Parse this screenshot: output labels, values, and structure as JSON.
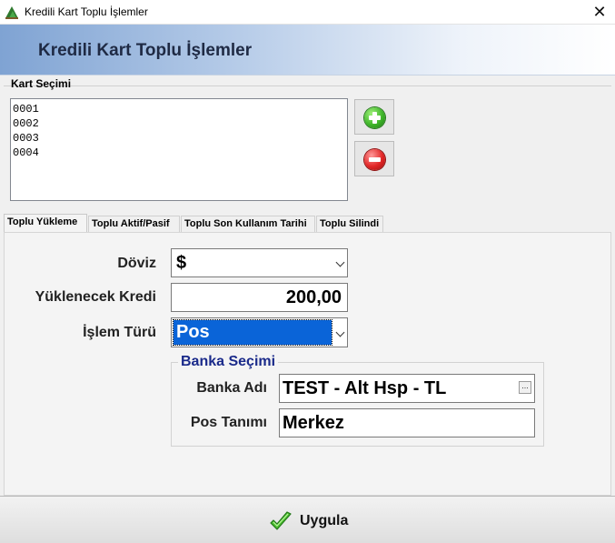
{
  "window": {
    "title": "Kredili Kart Toplu İşlemler",
    "close_symbol": "✕"
  },
  "header": {
    "heading": "Kredili Kart Toplu İşlemler"
  },
  "card_selection": {
    "label": "Kart Seçimi",
    "items": [
      "0001",
      "0002",
      "0003",
      "0004"
    ],
    "add_icon": "green-plus-icon",
    "remove_icon": "red-minus-icon"
  },
  "tabs": [
    {
      "label": "Toplu Yükleme",
      "active": true
    },
    {
      "label": "Toplu Aktif/Pasif",
      "active": false
    },
    {
      "label": "Toplu Son Kullanım Tarihi",
      "active": false
    },
    {
      "label": "Toplu Silindi",
      "active": false
    }
  ],
  "form": {
    "currency_label": "Döviz",
    "currency_value": "$",
    "credit_label": "Yüklenecek Kredi",
    "credit_value": "200,00",
    "operation_label": "İşlem Türü",
    "operation_value": "Pos"
  },
  "bank": {
    "group_title": "Banka Seçimi",
    "name_label": "Banka Adı",
    "name_value": "TEST - Alt Hsp - TL",
    "ellipsis": "...",
    "pos_label": "Pos Tanımı",
    "pos_value": "Merkez"
  },
  "footer": {
    "apply_label": "Uygula",
    "apply_icon": "green-check-icon"
  },
  "colors": {
    "selection": "#0a64d8",
    "group_title": "#1a2a8a"
  }
}
